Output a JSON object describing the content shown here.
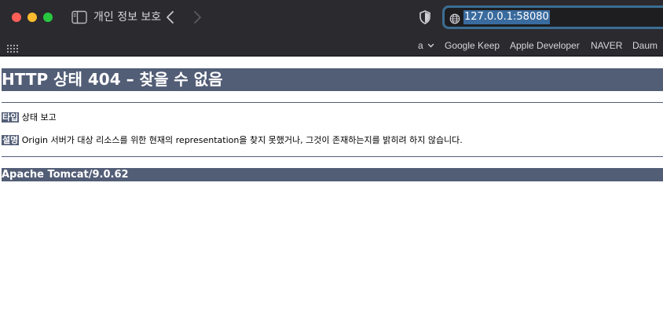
{
  "browser": {
    "tab_title": "개인 정보 보호",
    "url": "127.0.0.1:58080",
    "bookmarks": [
      "a",
      "Google Keep",
      "Apple Developer",
      "NAVER",
      "Daum"
    ]
  },
  "page": {
    "title": "HTTP 상태 404 – 찾을 수 없음",
    "type_label": "타입",
    "type_value": "상태 보고",
    "desc_label": "설명",
    "desc_value": "Origin 서버가 대상 리소스를 위한 현재의 representation을 찾지 못했거나, 그것이 존재하는지를 밝히려 하지 않습니다.",
    "footer": "Apache Tomcat/9.0.62"
  },
  "colors": {
    "chrome_bg": "#2b2a2f",
    "tomcat_header": "#525d76",
    "url_focus": "#3b6e93"
  }
}
